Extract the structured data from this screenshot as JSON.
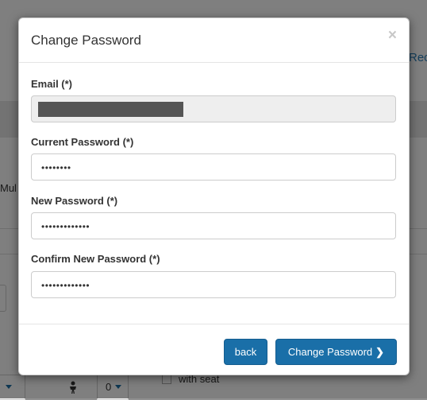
{
  "background": {
    "link_partial": "Rec",
    "label_partial": "Mul",
    "select_left_value": "",
    "select_right_value": "0",
    "seat_label": "with seat",
    "person_icon": "person-icon"
  },
  "modal": {
    "title": "Change Password",
    "close_symbol": "×",
    "fields": {
      "email": {
        "label": "Email (*)",
        "value": ""
      },
      "current_password": {
        "label": "Current Password (*)",
        "value": "••••••••"
      },
      "new_password": {
        "label": "New Password (*)",
        "value": "•••••••••••••"
      },
      "confirm_password": {
        "label": "Confirm New Password (*)",
        "value": "•••••••••••••"
      }
    },
    "buttons": {
      "back": "back",
      "submit": "Change Password"
    }
  },
  "colors": {
    "primary": "#1a6fa8",
    "link": "#2a7fb8"
  }
}
